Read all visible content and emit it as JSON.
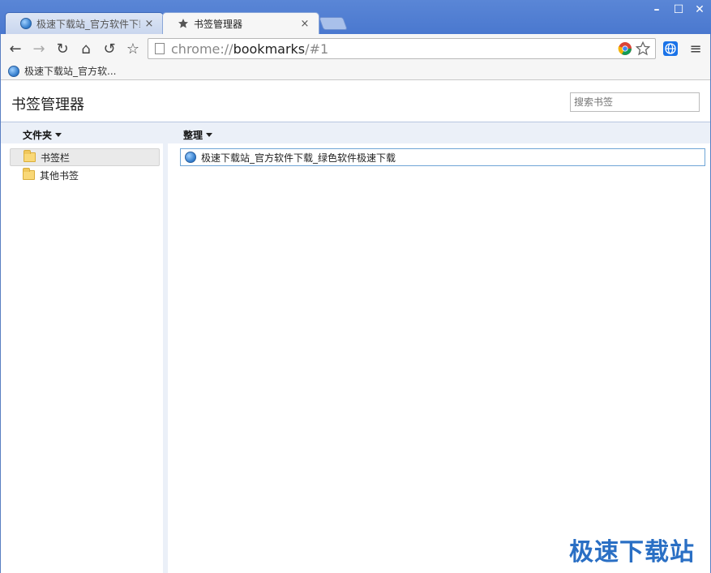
{
  "tabs": [
    {
      "label": "极速下载站_官方软件下载",
      "close": "×"
    },
    {
      "label": "书签管理器",
      "close": "×"
    }
  ],
  "window_controls": {
    "minimize": "–",
    "maximize": "☐",
    "close": "✕"
  },
  "toolbar": {
    "back": "←",
    "forward": "→",
    "reload": "↻",
    "home": "⌂",
    "undo": "↺",
    "star": "☆",
    "menu": "≡"
  },
  "omnibox": {
    "scheme": "chrome://",
    "host": "bookmarks",
    "rest": "/#1"
  },
  "bookmarks_bar": {
    "items": [
      {
        "label": "极速下载站_官方软..."
      }
    ]
  },
  "page": {
    "title": "书签管理器",
    "search_placeholder": "搜索书签",
    "folders_menu": "文件夹",
    "organize_menu": "整理"
  },
  "folders": [
    {
      "label": "书签栏",
      "selected": true
    },
    {
      "label": "其他书签",
      "selected": false
    }
  ],
  "bookmarks": [
    {
      "label": "极速下载站_官方软件下载_绿色软件极速下载"
    }
  ],
  "watermark": "极速下载站",
  "colors": {
    "titlebar": "#4a78cf",
    "selection_border": "#6fa5d6",
    "header_band": "#ebf0f8",
    "watermark": "#2a6fc4"
  }
}
